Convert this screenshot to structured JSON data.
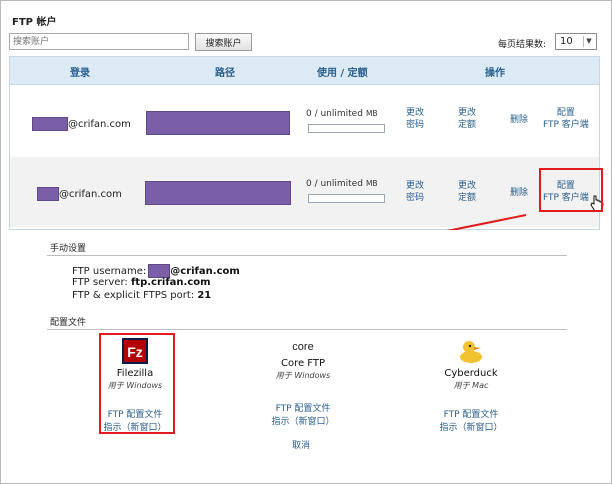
{
  "page": {
    "title": "FTP 帐户"
  },
  "search": {
    "placeholder": "搜索账户",
    "button_label": "搜索账户"
  },
  "pagination": {
    "label": "每页结果数:",
    "value": "10"
  },
  "table": {
    "headers": {
      "login": "登录",
      "path": "路径",
      "usage": "使用 / 定额",
      "actions": "操作"
    },
    "rows": [
      {
        "email_suffix": "@crifan.com",
        "usage": "0 / unlimited",
        "unit": "MB",
        "usage_fraction": 0,
        "actions": {
          "change_pw_1": "更改",
          "change_pw_2": "密码",
          "change_quota_1": "更改",
          "change_quota_2": "定额",
          "delete": "删除",
          "configure_1": "配置",
          "configure_2": "FTP 客户端"
        }
      },
      {
        "email_suffix": "@crifan.com",
        "usage": "0 / unlimited",
        "unit": "MB",
        "usage_fraction": 0,
        "actions": {
          "change_pw_1": "更改",
          "change_pw_2": "密码",
          "change_quota_1": "更改",
          "change_quota_2": "定额",
          "delete": "删除",
          "configure_1": "配置",
          "configure_2": "FTP 客户端"
        }
      }
    ]
  },
  "manual": {
    "heading": "手动设置",
    "username_label": "FTP username:",
    "username_suffix": "@crifan.com",
    "server_label": "FTP server:",
    "server_value": "ftp.crifan.com",
    "port_label": "FTP & explicit FTPS port:",
    "port_value": "21"
  },
  "config_files": {
    "heading": "配置文件",
    "clients": [
      {
        "name": "Filezilla",
        "platform": "用于 Windows",
        "link1": "FTP 配置文件",
        "link2": "指示（新窗口）",
        "icon": "filezilla-icon"
      },
      {
        "name": "Core FTP",
        "platform": "用于 Windows",
        "link1": "FTP 配置文件",
        "link2": "指示（新窗口）",
        "icon": "coreftp-icon",
        "logo_text": "core"
      },
      {
        "name": "Cyberduck",
        "platform": "用于 Mac",
        "link1": "FTP 配置文件",
        "link2": "指示（新窗口）",
        "icon": "cyberduck-icon"
      }
    ],
    "cancel": "取消"
  },
  "colors": {
    "header_bg": "#dceaf6",
    "link": "#2a5f8e",
    "highlight": "#e21c1c",
    "mask": "#7a5fa8"
  }
}
